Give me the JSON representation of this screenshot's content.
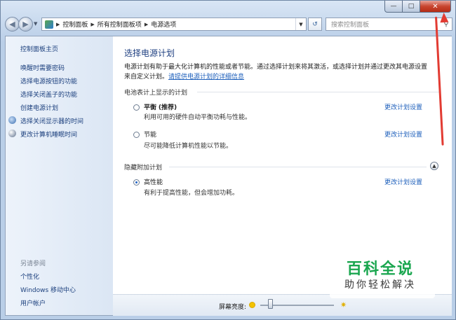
{
  "window": {
    "caption_buttons": {
      "minimize": "—",
      "maximize": "□",
      "close": "✕"
    }
  },
  "address_bar": {
    "crumbs": [
      "控制面板",
      "所有控制面板项",
      "电源选项"
    ],
    "search_placeholder": "搜索控制面板"
  },
  "sidebar": {
    "home": "控制面板主页",
    "links": [
      "唤醒时需要密码",
      "选择电源按钮的功能",
      "选择关闭盖子的功能",
      "创建电源计划",
      "选择关闭显示器的时间",
      "更改计算机睡眠时间"
    ],
    "see_also_header": "另请参阅",
    "see_also": [
      "个性化",
      "Windows 移动中心",
      "用户帐户"
    ]
  },
  "main": {
    "title": "选择电源计划",
    "description_line1": "电源计划有助于最大化计算机的性能或者节能。通过选择计划来将其激活，或选择计划并通过更改其电源设置",
    "description_line2_prefix": "来自定义计划。",
    "description_link": "请提供电源计划的详细信息",
    "battery_section": "电池表计上显示的计划",
    "plans": [
      {
        "name": "平衡",
        "tag": "(推荐)",
        "desc": "利用可用的硬件自动平衡功耗与性能。",
        "link": "更改计划设置",
        "selected": false
      },
      {
        "name": "节能",
        "tag": "",
        "desc": "尽可能降低计算机性能以节能。",
        "link": "更改计划设置",
        "selected": false
      }
    ],
    "hidden_section": "隐藏附加计划",
    "hidden_plans": [
      {
        "name": "高性能",
        "desc": "有利于提高性能，但会增加功耗。",
        "link": "更改计划设置",
        "selected": true
      }
    ]
  },
  "brightness": {
    "label": "屏幕亮度:",
    "level": 0.11
  },
  "watermark": {
    "title": "百科全说",
    "subtitle": "助你轻松解决"
  },
  "colors": {
    "accent": "#1d5fbb",
    "arrow": "#e23b32",
    "watermark": "#1aa64f"
  }
}
